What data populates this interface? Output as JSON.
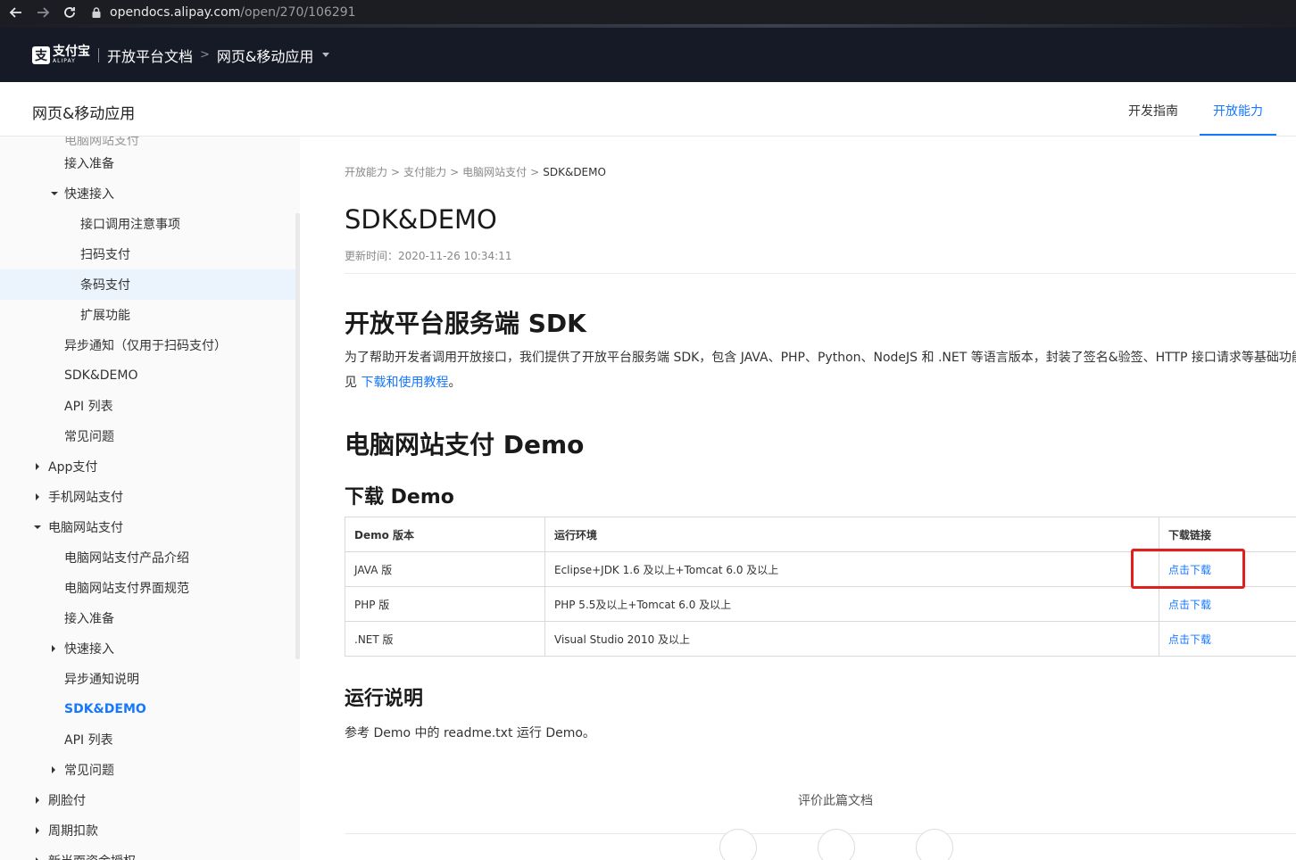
{
  "browser": {
    "url_host": "opendocs.alipay.com",
    "url_path": "/open/270/106291"
  },
  "header": {
    "logo_cn": "支付宝",
    "logo_en": "ALIPAY",
    "title": "开放平台文档",
    "crumb_sep": ">",
    "app": "网页&移动应用"
  },
  "subheader": {
    "title": "网页&移动应用",
    "tabs": [
      {
        "label": "开发指南"
      },
      {
        "label": "开放能力"
      }
    ]
  },
  "sidebar": {
    "cut_item": "电脑网站支付",
    "items": [
      {
        "label": "接入准备"
      },
      {
        "label": "快速接入"
      },
      {
        "label": "接口调用注意事项"
      },
      {
        "label": "扫码支付"
      },
      {
        "label": "条码支付"
      },
      {
        "label": "扩展功能"
      },
      {
        "label": "异步通知（仅用于扫码支付）"
      },
      {
        "label": "SDK&DEMO"
      },
      {
        "label": "API 列表"
      },
      {
        "label": "常见问题"
      },
      {
        "label": "App支付"
      },
      {
        "label": "手机网站支付"
      },
      {
        "label": "电脑网站支付"
      },
      {
        "label": "电脑网站支付产品介绍"
      },
      {
        "label": "电脑网站支付界面规范"
      },
      {
        "label": "接入准备"
      },
      {
        "label": "快速接入"
      },
      {
        "label": "异步通知说明"
      },
      {
        "label": "SDK&DEMO"
      },
      {
        "label": "API 列表"
      },
      {
        "label": "常见问题"
      },
      {
        "label": "刷脸付"
      },
      {
        "label": "周期扣款"
      },
      {
        "label": "新当面资金授权"
      }
    ]
  },
  "main": {
    "breadcrumb": [
      "开放能力",
      "支付能力",
      "电脑网站支付",
      "SDK&DEMO"
    ],
    "breadcrumb_sep": ">",
    "title": "SDK&DEMO",
    "update_time": "更新时间：2020-11-26 10:34:11",
    "sdk_heading": "开放平台服务端 SDK",
    "sdk_desc": "为了帮助开发者调用开放接口，我们提供了开放平台服务端 SDK，包含 JAVA、PHP、Python、NodeJS 和 .NET 等语言版本，封装了签名&验签、HTTP 接口请求等基础功能",
    "sdk_see": "见 ",
    "sdk_link": "下载和使用教程",
    "sdk_end": "。",
    "demo_heading": "电脑网站支付 Demo",
    "download_heading": "下载 Demo",
    "table": {
      "headers": [
        "Demo 版本",
        "运行环境",
        "下载链接"
      ],
      "rows": [
        [
          "JAVA 版",
          "Eclipse+JDK 1.6 及以上+Tomcat 6.0 及以上",
          "点击下载"
        ],
        [
          "PHP 版",
          "PHP 5.5及以上+Tomcat 6.0 及以上",
          "点击下载"
        ],
        [
          ".NET 版",
          "Visual Studio 2010 及以上",
          "点击下载"
        ]
      ]
    },
    "run_heading": "运行说明",
    "run_desc": "参考 Demo 中的 readme.txt 运行 Demo。",
    "rate_label": "评价此篇文档"
  },
  "colors": {
    "accent": "#1677ff",
    "header_bg": "#161a26",
    "highlight_box": "#e0201c"
  }
}
